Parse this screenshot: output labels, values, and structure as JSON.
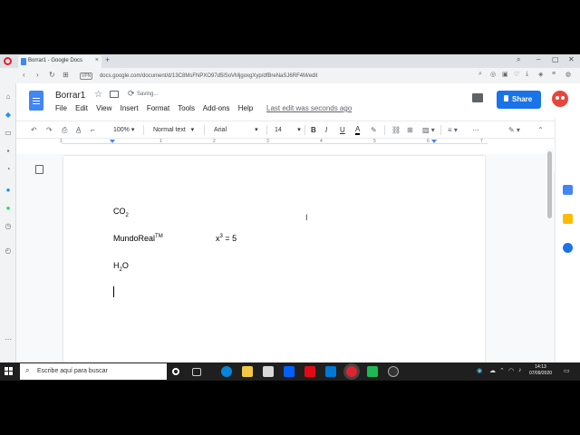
{
  "browser": {
    "tab_title": "Borrar1 - Google Docs",
    "new_tab_label": "+",
    "url": "docs.google.com/document/d/13C8MsFNPXO97d5lSoVMjgoxgXyp/dfBreNaSJ6RF4M/edit",
    "vpn_label": "VPN"
  },
  "docs": {
    "title": "Borrar1",
    "saving_text": "Saving...",
    "menu": [
      "File",
      "Edit",
      "View",
      "Insert",
      "Format",
      "Tools",
      "Add-ons",
      "Help"
    ],
    "last_edit": "Last edit was seconds ago",
    "share_label": "Share",
    "toolbar": {
      "zoom": "100%",
      "style": "Normal text",
      "font": "Arial",
      "size": "14"
    },
    "ruler_numbers": [
      "1",
      "1",
      "2",
      "3",
      "4",
      "5",
      "6",
      "7"
    ]
  },
  "document": {
    "line1": {
      "base": "CO",
      "sub": "2"
    },
    "line2": {
      "base": "MundoReal",
      "sup": "TM",
      "eq_base": "x",
      "eq_sup": "3",
      "eq_rest": " = 5"
    },
    "line3": {
      "base": "H",
      "sub": "2",
      "rest": "O"
    }
  },
  "taskbar": {
    "search_placeholder": "Escribe aquí para buscar",
    "time": "14:13",
    "date": "07/09/2020"
  },
  "colors": {
    "share_blue": "#1a73e8",
    "docs_blue": "#4285f4",
    "opera_red": "#e0232e"
  }
}
